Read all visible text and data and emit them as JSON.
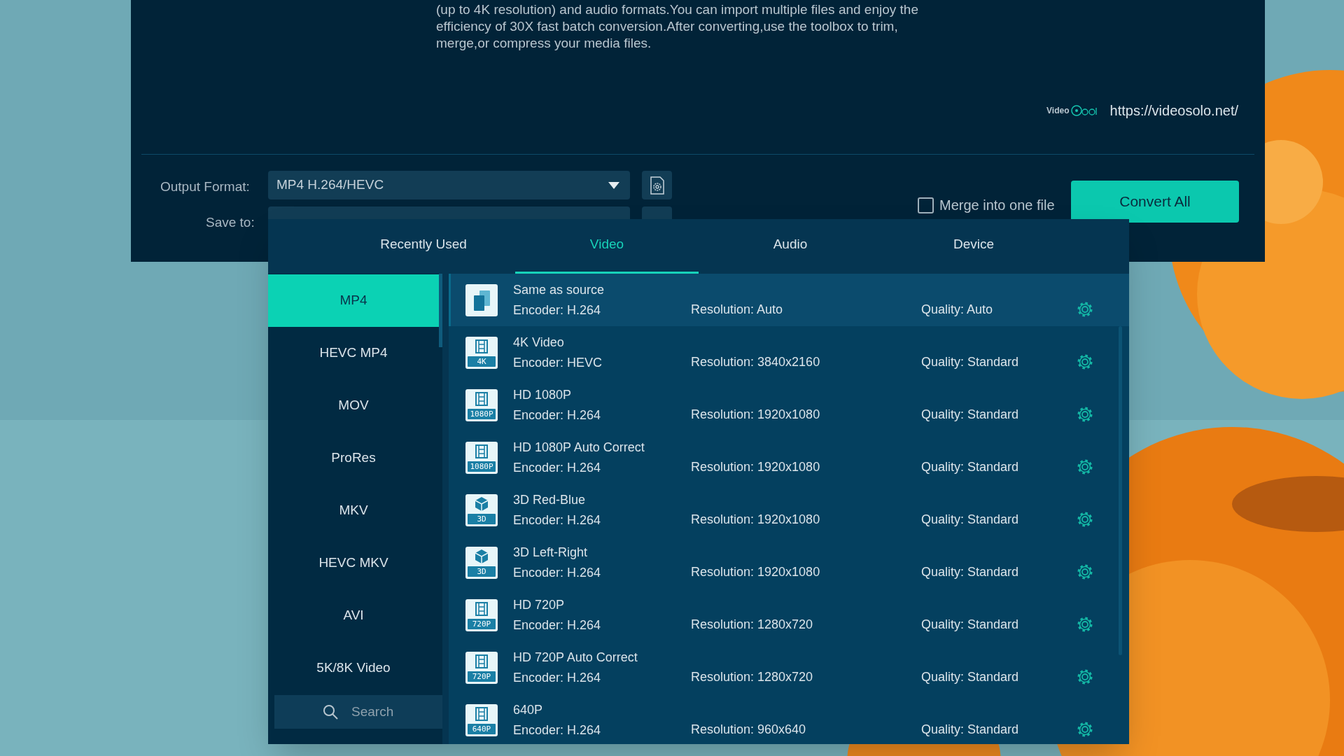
{
  "description": [
    "(up to 4K resolution) and audio formats.You can import multiple files and enjoy the",
    "efficiency of 30X fast batch conversion.After converting,use the toolbox to trim,",
    "merge,or compress your media files."
  ],
  "brand": {
    "logo_text": "Video",
    "url": "https://videosolo.net/"
  },
  "output_format": {
    "label": "Output Format:",
    "value": "MP4 H.264/HEVC"
  },
  "save_to": {
    "label": "Save to:"
  },
  "merge": {
    "label": "Merge into one file",
    "checked": false
  },
  "convert_button": "Convert All",
  "format_popup": {
    "tabs": [
      {
        "label": "Recently Used",
        "selected": false
      },
      {
        "label": "Video",
        "selected": true
      },
      {
        "label": "Audio",
        "selected": false
      },
      {
        "label": "Device",
        "selected": false
      }
    ],
    "categories": [
      {
        "label": "MP4",
        "selected": true
      },
      {
        "label": "HEVC MP4",
        "selected": false
      },
      {
        "label": "MOV",
        "selected": false
      },
      {
        "label": "ProRes",
        "selected": false
      },
      {
        "label": "MKV",
        "selected": false
      },
      {
        "label": "HEVC MKV",
        "selected": false
      },
      {
        "label": "AVI",
        "selected": false
      },
      {
        "label": "5K/8K Video",
        "selected": false
      }
    ],
    "search": {
      "placeholder": "Search"
    },
    "presets": [
      {
        "kind": "source",
        "name": "Same as source",
        "encoder": "Encoder: H.264",
        "resolution": "Resolution: Auto",
        "quality": "Quality: Auto",
        "selected": true
      },
      {
        "kind": "film",
        "badge": "4K",
        "name": "4K Video",
        "encoder": "Encoder: HEVC",
        "resolution": "Resolution: 3840x2160",
        "quality": "Quality: Standard",
        "selected": false
      },
      {
        "kind": "film",
        "badge": "1080P",
        "name": "HD 1080P",
        "encoder": "Encoder: H.264",
        "resolution": "Resolution: 1920x1080",
        "quality": "Quality: Standard",
        "selected": false
      },
      {
        "kind": "film",
        "badge": "1080P",
        "name": "HD 1080P Auto Correct",
        "encoder": "Encoder: H.264",
        "resolution": "Resolution: 1920x1080",
        "quality": "Quality: Standard",
        "selected": false
      },
      {
        "kind": "cube",
        "badge": "3D",
        "name": "3D Red-Blue",
        "encoder": "Encoder: H.264",
        "resolution": "Resolution: 1920x1080",
        "quality": "Quality: Standard",
        "selected": false
      },
      {
        "kind": "cube",
        "badge": "3D",
        "name": "3D Left-Right",
        "encoder": "Encoder: H.264",
        "resolution": "Resolution: 1920x1080",
        "quality": "Quality: Standard",
        "selected": false
      },
      {
        "kind": "film",
        "badge": "720P",
        "name": "HD 720P",
        "encoder": "Encoder: H.264",
        "resolution": "Resolution: 1280x720",
        "quality": "Quality: Standard",
        "selected": false
      },
      {
        "kind": "film",
        "badge": "720P",
        "name": "HD 720P Auto Correct",
        "encoder": "Encoder: H.264",
        "resolution": "Resolution: 1280x720",
        "quality": "Quality: Standard",
        "selected": false
      },
      {
        "kind": "film",
        "badge": "640P",
        "name": "640P",
        "encoder": "Encoder: H.264",
        "resolution": "Resolution: 960x640",
        "quality": "Quality: Standard",
        "selected": false
      }
    ]
  }
}
